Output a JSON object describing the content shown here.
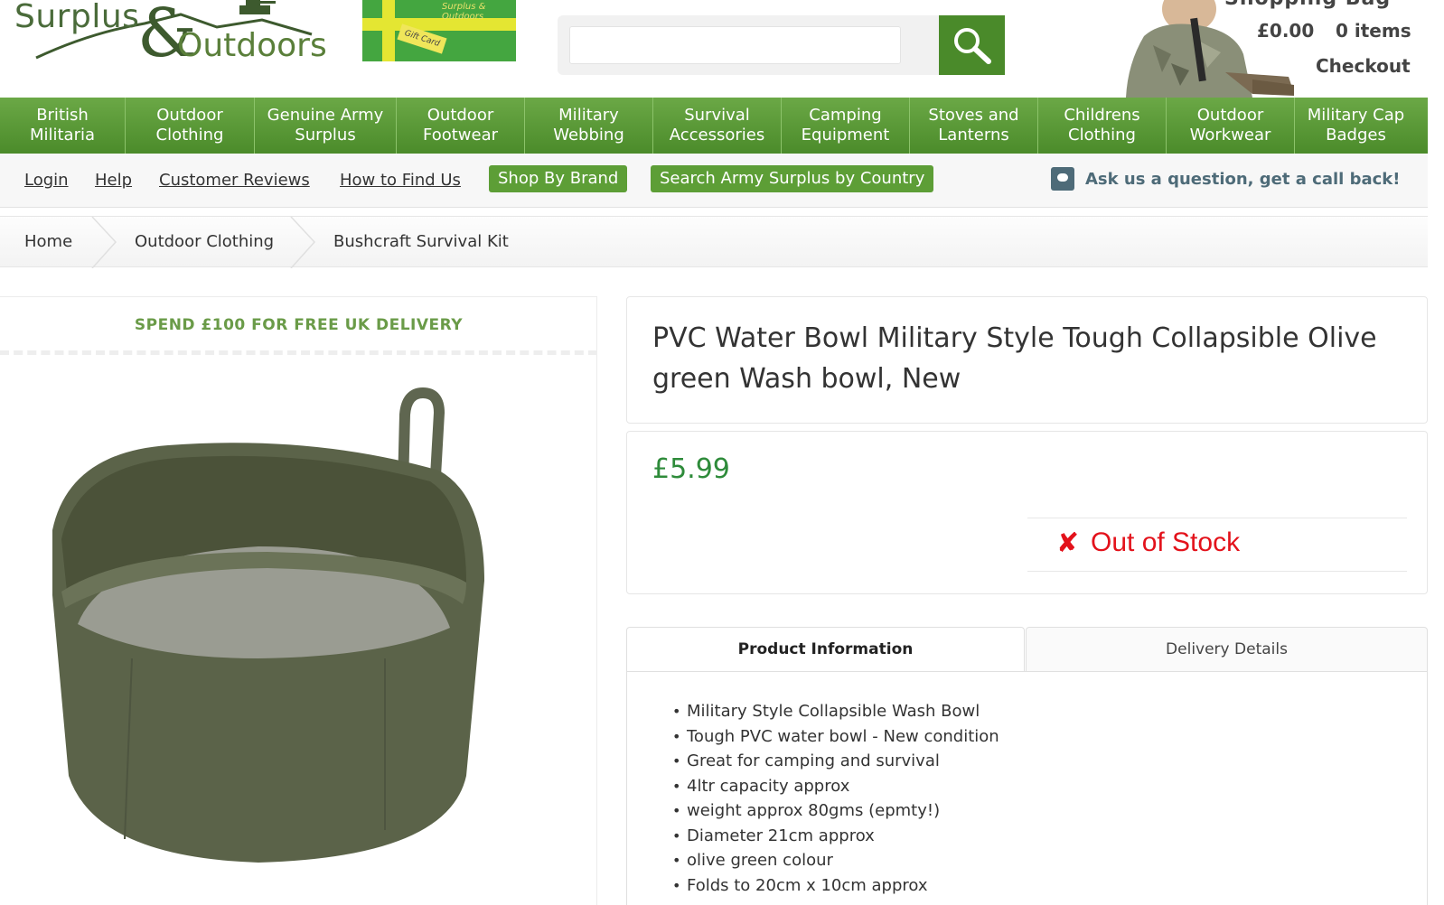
{
  "header": {
    "logo_text_1": "Surplus",
    "logo_amp": "&",
    "logo_text_2": "Outdoors",
    "giftcard_brand": "Surplus & Outdoors",
    "giftcard_tag": "Gift Card",
    "search_placeholder": "",
    "cart_title": "Shopping Bag",
    "cart_total": "£0.00",
    "cart_items": "0 items",
    "checkout_label": "Checkout"
  },
  "nav": {
    "items": [
      {
        "line1": "British Militaria",
        "line2": ""
      },
      {
        "line1": "Outdoor",
        "line2": "Clothing"
      },
      {
        "line1": "Genuine Army",
        "line2": "Surplus"
      },
      {
        "line1": "Outdoor",
        "line2": "Footwear"
      },
      {
        "line1": "Military",
        "line2": "Webbing"
      },
      {
        "line1": "Survival",
        "line2": "Accessories"
      },
      {
        "line1": "Camping",
        "line2": "Equipment"
      },
      {
        "line1": "Stoves and",
        "line2": "Lanterns"
      },
      {
        "line1": "Childrens",
        "line2": "Clothing"
      },
      {
        "line1": "Outdoor",
        "line2": "Workwear"
      },
      {
        "line1": "Military Cap",
        "line2": "Badges"
      }
    ]
  },
  "subnav": {
    "login": "Login",
    "help": "Help",
    "reviews": "Customer Reviews",
    "find_us": "How to Find Us",
    "shop_by_brand": "Shop By Brand",
    "search_by_country": "Search Army Surplus by Country",
    "ask": "Ask us a question, get a call back!"
  },
  "breadcrumb": {
    "home": "Home",
    "category": "Outdoor Clothing",
    "current": "Bushcraft Survival Kit"
  },
  "promo": {
    "delivery": "SPEND £100 FOR FREE UK DELIVERY"
  },
  "product": {
    "title": "PVC Water Bowl Military Style Tough Collapsible Olive green Wash bowl, New",
    "price": "£5.99",
    "stock_icon": "x-icon",
    "stock_status": "Out of Stock",
    "colors": {
      "price": "#2e8b3a",
      "out_of_stock": "#e3121b",
      "brand_green": "#5d9e36"
    }
  },
  "tabs": {
    "product_info": "Product Information",
    "delivery": "Delivery Details"
  },
  "features": [
    "Military Style Collapsible Wash Bowl",
    "Tough PVC water bowl - New condition",
    "Great for camping and survival",
    "4ltr capacity approx",
    "weight approx 80gms (epmty!)",
    "Diameter 21cm approx",
    "olive green colour",
    "Folds to 20cm x 10cm approx"
  ]
}
